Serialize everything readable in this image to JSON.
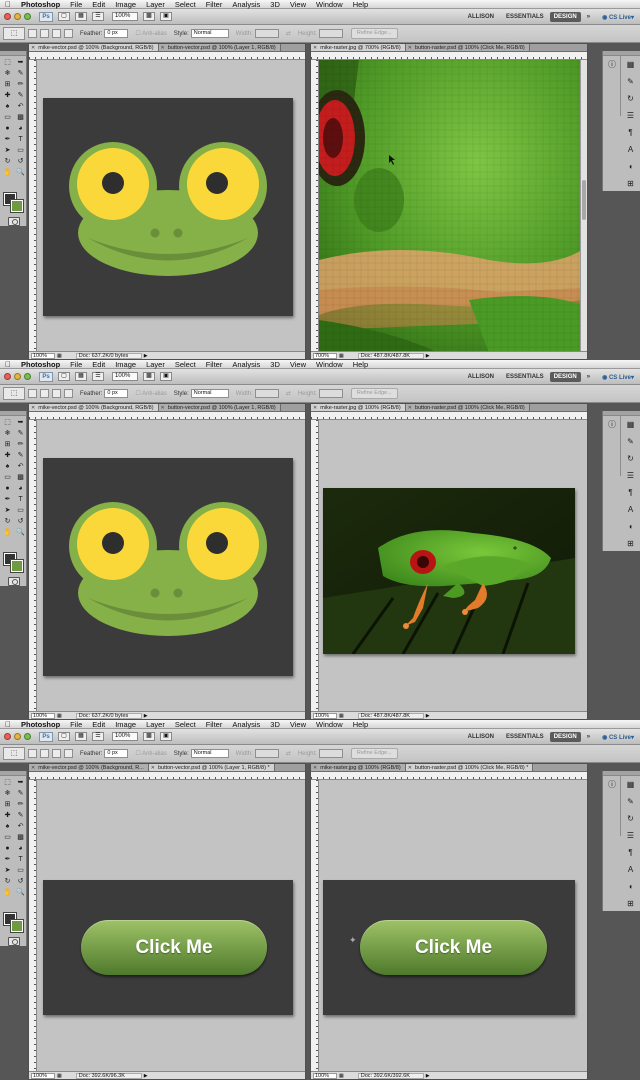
{
  "menubar": {
    "app_name": "Photoshop",
    "items": [
      "File",
      "Edit",
      "Image",
      "Layer",
      "Select",
      "Filter",
      "Analysis",
      "3D",
      "View",
      "Window",
      "Help"
    ]
  },
  "appbar": {
    "ps_logo": "Ps",
    "zoom": "100%",
    "workspaces": [
      "ALLISON",
      "ESSENTIALS",
      "DESIGN"
    ],
    "active_workspace": "DESIGN",
    "cs_live": "CS Live"
  },
  "options": {
    "feather_label": "Feather:",
    "feather_value": "0 px",
    "antialias_label": "Anti-alias",
    "style_label": "Style:",
    "style_value": "Normal",
    "width_label": "Width:",
    "height_label": "Height:",
    "refine_edge": "Refine Edge..."
  },
  "screens": [
    {
      "left_doc": {
        "tabs": [
          {
            "title": "mike-vector.psd @ 100% (Background, RGB/8)",
            "active": true
          },
          {
            "title": "button-vector.psd @ 100% (Layer 1, RGB/8)",
            "active": false
          }
        ],
        "zoom": "100%",
        "doc_info": "Doc: 637.2K/0 bytes"
      },
      "right_doc": {
        "tabs": [
          {
            "title": "mike-raster.jpg @ 700% (RGB/8)",
            "active": true
          },
          {
            "title": "button-raster.psd @ 100% (Click Me, RGB/8)",
            "active": false
          }
        ],
        "zoom": "700%",
        "doc_info": "Doc: 487.8K/487.8K"
      }
    },
    {
      "left_doc": {
        "tabs": [
          {
            "title": "mike-vector.psd @ 100% (Background, RGB/8)",
            "active": true
          },
          {
            "title": "button-vector.psd @ 100% (Layer 1, RGB/8)",
            "active": false
          }
        ],
        "zoom": "100%",
        "doc_info": "Doc: 637.2K/0 bytes"
      },
      "right_doc": {
        "tabs": [
          {
            "title": "mike-raster.jpg @ 100% (RGB/8)",
            "active": true
          },
          {
            "title": "button-raster.psd @ 100% (Click Me, RGB/8)",
            "active": false
          }
        ],
        "zoom": "100%",
        "doc_info": "Doc: 487.8K/487.8K"
      }
    },
    {
      "left_doc": {
        "tabs": [
          {
            "title": "mike-vector.psd @ 100% (Background, R...",
            "active": false
          },
          {
            "title": "button-vector.psd @ 100% (Layer 1, RGB/8) *",
            "active": true
          }
        ],
        "zoom": "100%",
        "doc_info": "Doc: 392.6K/96.3K",
        "button_label": "Click Me"
      },
      "right_doc": {
        "tabs": [
          {
            "title": "mike-raster.jpg @ 100% (RGB/8)",
            "active": false
          },
          {
            "title": "button-raster.psd @ 100% (Click Me, RGB/8) *",
            "active": true
          }
        ],
        "zoom": "100%",
        "doc_info": "Doc: 392.6K/392.6K",
        "button_label": "Click Me"
      }
    }
  ],
  "colors": {
    "canvas_dark": "#3b3b3b",
    "frog_green": "#86b048",
    "frog_dark_green": "#6b8e3a",
    "eye_yellow": "#fbd839",
    "pupil": "#2e2e2e",
    "button_top": "#9ec267",
    "button_bottom": "#4f7a2c"
  }
}
